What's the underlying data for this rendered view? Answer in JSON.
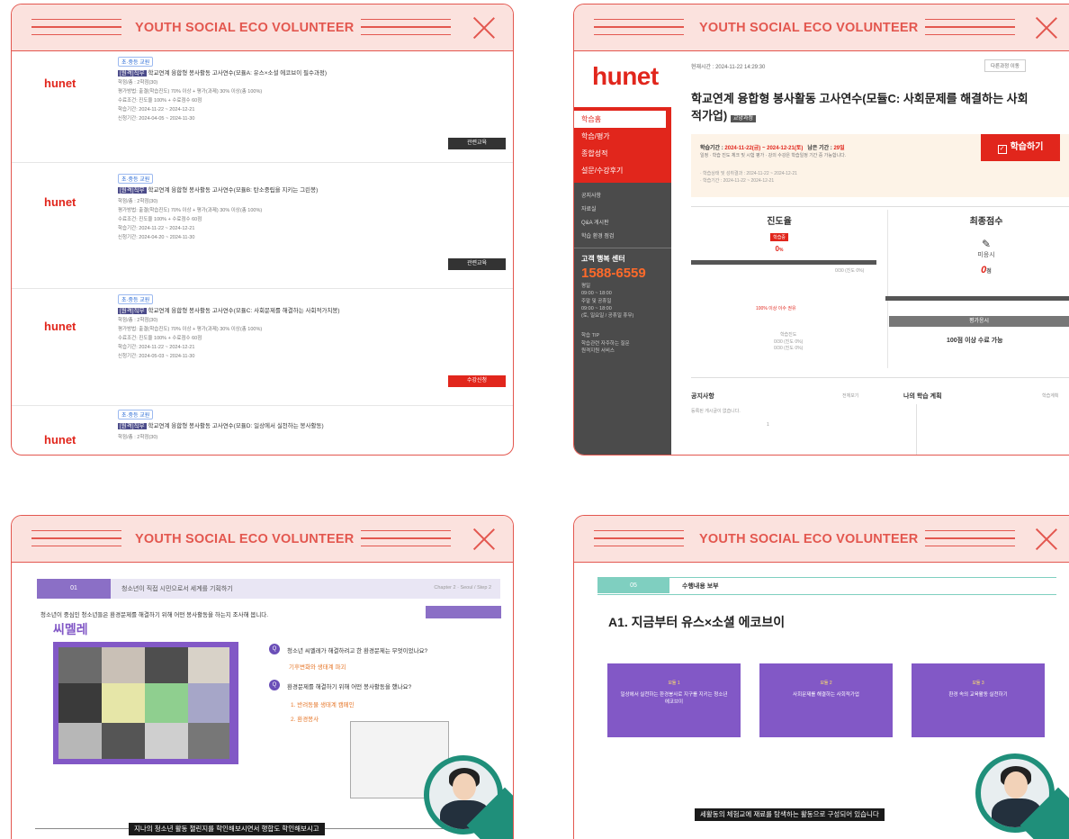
{
  "window_title": "YOUTH SOCIAL ECO VOLUNTEER",
  "brand": "hunet",
  "course_list": {
    "tag": "초·중등 교원",
    "courses": [
      {
        "badge": "[원격]직무",
        "title": "학교연계 융합형 봉사활동 고사연수(모듈A: 유스×소셜 에코브이 필수과정)",
        "lines": [
          "학점/총 : 2학점(30)",
          "평가방법: 출결(학습진도) 70% 이상 + 평가(과제) 30% 이상(총 100%)",
          "수료조건: 진도율 100% + 수료점수 60점",
          "학습기간: 2024-11-22 ~ 2024-12-21",
          "신청기간: 2024-04-05 ~ 2024-11-30"
        ],
        "button": "관련교육"
      },
      {
        "badge": "[원격]직무",
        "title": "학교연계 융합형 봉사활동 고사연수(모듈B: 탄소중립을 지키는 그린봉)",
        "lines": [
          "학점/총 : 2학점(30)",
          "평가방법: 출결(학습진도) 70% 이상 + 평가(과제) 30% 이상(총 100%)",
          "수료조건: 진도율 100% + 수료점수 60점",
          "학습기간: 2024-11-22 ~ 2024-12-21",
          "신청기간: 2024-04-20 ~ 2024-11-30"
        ],
        "button": "관련교육"
      },
      {
        "badge": "[원격]직무",
        "title": "학교연계 융합형 봉사활동 고사연수(모듈C: 사회문제를 해결하는 사회적가치봉)",
        "lines": [
          "학점/총 : 2학점(30)",
          "평가방법: 출결(학습진도) 70% 이상 + 평가(과제) 30% 이상(총 100%)",
          "수료조건: 진도율 100% + 수료점수 60점",
          "학습기간: 2024-11-22 ~ 2024-12-21",
          "신청기간: 2024-05-03 ~ 2024-11-30"
        ],
        "button": "수강신청"
      },
      {
        "badge": "[원격]직무",
        "title": "학교연계 융합형 봉사활동 고사연수(모듈D: 일상에서 실천하는 봉사활동)",
        "lines": [
          "학점/총 : 2학점(30)"
        ],
        "button": ""
      }
    ]
  },
  "lms": {
    "topbar_left": "현재시간 : 2024-11-22 14:29:30",
    "topbar_right": "다른과정 이동",
    "title": "학교연계 융합형 봉사활동 고사연수(모듈C: 사회문제를 해결하는 사회적가업)",
    "title_badge": "교양과정",
    "menu": [
      "학습홈",
      "학습/평가",
      "종합성적",
      "설문/수강후기"
    ],
    "submenu": [
      "공지사항",
      "자료실",
      "Q&A 게시판",
      "학습 환경 점검"
    ],
    "cs_title": "고객 행복 센터",
    "cs_phone": "1588-6559",
    "cs_info": [
      "평일",
      "09:00 ~ 18:00",
      "주말 및 공휴일",
      "09:00 ~ 18:00",
      "(토, 일요일 / 공휴일 휴무)"
    ],
    "cs_extra": [
      "학습 TIP",
      "학습관련 자주하는 질문",
      "원격지원 서비스"
    ],
    "period_label": "학습기간 : ",
    "period_value": "2024-11-22(금) ~ 2024-12-21(토)",
    "remain_label": "남은 기간 : ",
    "remain_value": "29일",
    "period_note": "일정 · 학습 진도 체크 및 시험 평가 · 강의 수강은 학습일정 기간 중 가능합니다.",
    "period_sub": [
      "· 학습상태 및 성취결과 : 2024-11-22 ~ 2024-12-21",
      "· 학습기간 : 2024-11-22 ~ 2024-12-21"
    ],
    "study_button": "학습하기",
    "progress_label": "진도율",
    "progress_badge": "학습중",
    "progress_value": "0",
    "progress_unit": "%",
    "progress_note": "100% 이상 이수 권유",
    "progress_sub": [
      "학습진도",
      "0/30 (진도 0%)",
      "0/30 (진도 0%)"
    ],
    "score_label": "최종점수",
    "score_state": "미응시",
    "score_value": "0",
    "score_unit": "점",
    "score_button": "평가응시",
    "score_note": "100점 이상 수료 가능",
    "notice_title": "공지사항",
    "notice_more": "전체보기",
    "notice_empty": "등록된 게시글이 없습니다.",
    "notice_page": "1",
    "plan_title": "나의 학습 계획",
    "plan_more": "학습계획"
  },
  "slide_a": {
    "num": "01",
    "header": "청소년이 직접 시민으로서 세계를 기획하기",
    "header_right": "Chapter 2 · Seoul / Step 2",
    "bullet": "청소년이 중심인 청소년들은 환경문제를 해결하기 위해 어떤 봉사활동을 하는지 조사해 봅니다.",
    "heading": "씨멜레",
    "q1": "청소년 씨멜레가 해결하려고 한 환경문제는 무엇이었나요?",
    "a1": "기후변화와 생태계 파괴",
    "q2": "환경문제를 해결하기 위해 어떤 봉사활동을 했나요?",
    "a2": [
      "1. 반려동물 생태계 캠페인",
      "2. 환경봉사"
    ],
    "subtitle": "지나의 청소년 활동 챌린지를 학인해보시면서 행합도 학인해보시고"
  },
  "slide_b": {
    "num": "05",
    "header": "수행내용 보부",
    "heading": "A1. 지금부터 유스×소셜 에코브이",
    "cards": [
      {
        "tag": "모듈 1",
        "text": "일상에서 실천하는 환경봉사로 지구를 지키는 청소년 에코브이"
      },
      {
        "tag": "모듈 2",
        "text": "사회문제를 해결하는 사회적가업"
      },
      {
        "tag": "모듈 3",
        "text": "환경 속의 교육활동 실천하기"
      }
    ],
    "subtitle": "세활동의 체험교에 재료를 탐색하는 활동으로 구성되어 있습니다"
  },
  "colors": {
    "accent": "#e3574f",
    "brand_red": "#e1261c",
    "purple": "#8258c6",
    "teal": "#1f8f7a"
  }
}
